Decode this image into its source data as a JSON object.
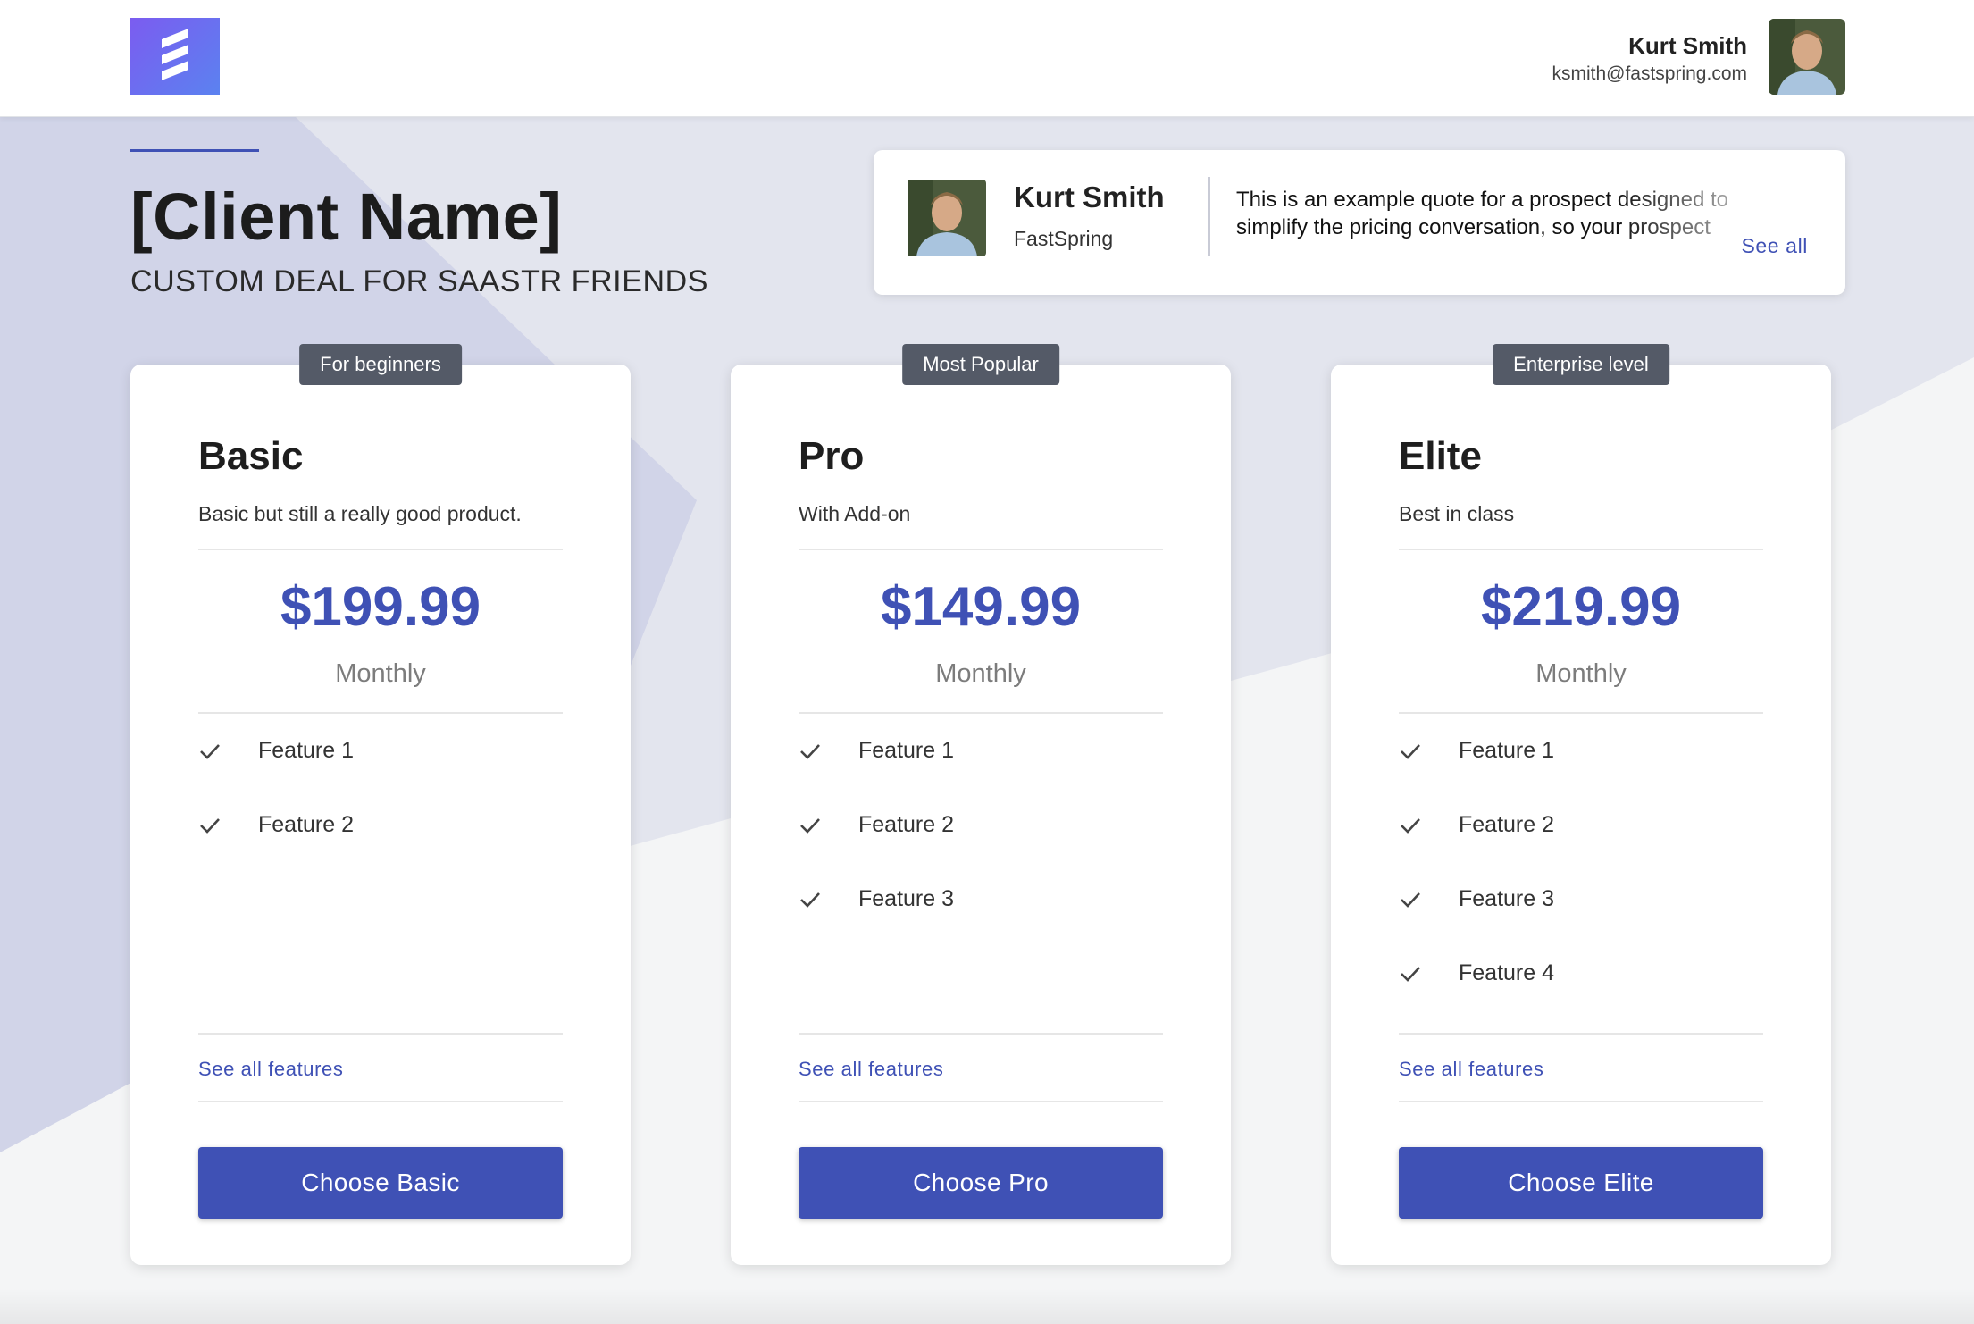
{
  "header": {
    "user_name": "Kurt Smith",
    "user_email": "ksmith@fastspring.com"
  },
  "title": {
    "client_name": "[Client Name]",
    "subtitle": "CUSTOM DEAL FOR SAASTR FRIENDS"
  },
  "quote": {
    "name": "Kurt Smith",
    "company": "FastSpring",
    "text": "This is an example quote for a prospect designed to simplify the pricing conversation, so your prospect",
    "see_all": "See all"
  },
  "plans": [
    {
      "badge": "For beginners",
      "name": "Basic",
      "description": "Basic but still a really good product.",
      "price": "$199.99",
      "period": "Monthly",
      "features": [
        "Feature 1",
        "Feature 2"
      ],
      "see_all_features": "See all features",
      "button": "Choose Basic"
    },
    {
      "badge": "Most Popular",
      "name": "Pro",
      "description": "With Add-on",
      "price": "$149.99",
      "period": "Monthly",
      "features": [
        "Feature 1",
        "Feature 2",
        "Feature 3"
      ],
      "see_all_features": "See all features",
      "button": "Choose Pro"
    },
    {
      "badge": "Enterprise level",
      "name": "Elite",
      "description": "Best in class",
      "price": "$219.99",
      "period": "Monthly",
      "features": [
        "Feature 1",
        "Feature 2",
        "Feature 3",
        "Feature 4"
      ],
      "see_all_features": "See all features",
      "button": "Choose Elite"
    }
  ],
  "colors": {
    "accent": "#3f51b5",
    "badge": "#545a67",
    "logo_gradient_start": "#7b5cf0",
    "logo_gradient_end": "#5b82f0",
    "bg_tint_dark": "#d1d4e8",
    "bg_tint_light": "#e3e5ee"
  },
  "icons": {
    "logo": "fastspring-logo-icon",
    "feature_check": "check-icon"
  }
}
